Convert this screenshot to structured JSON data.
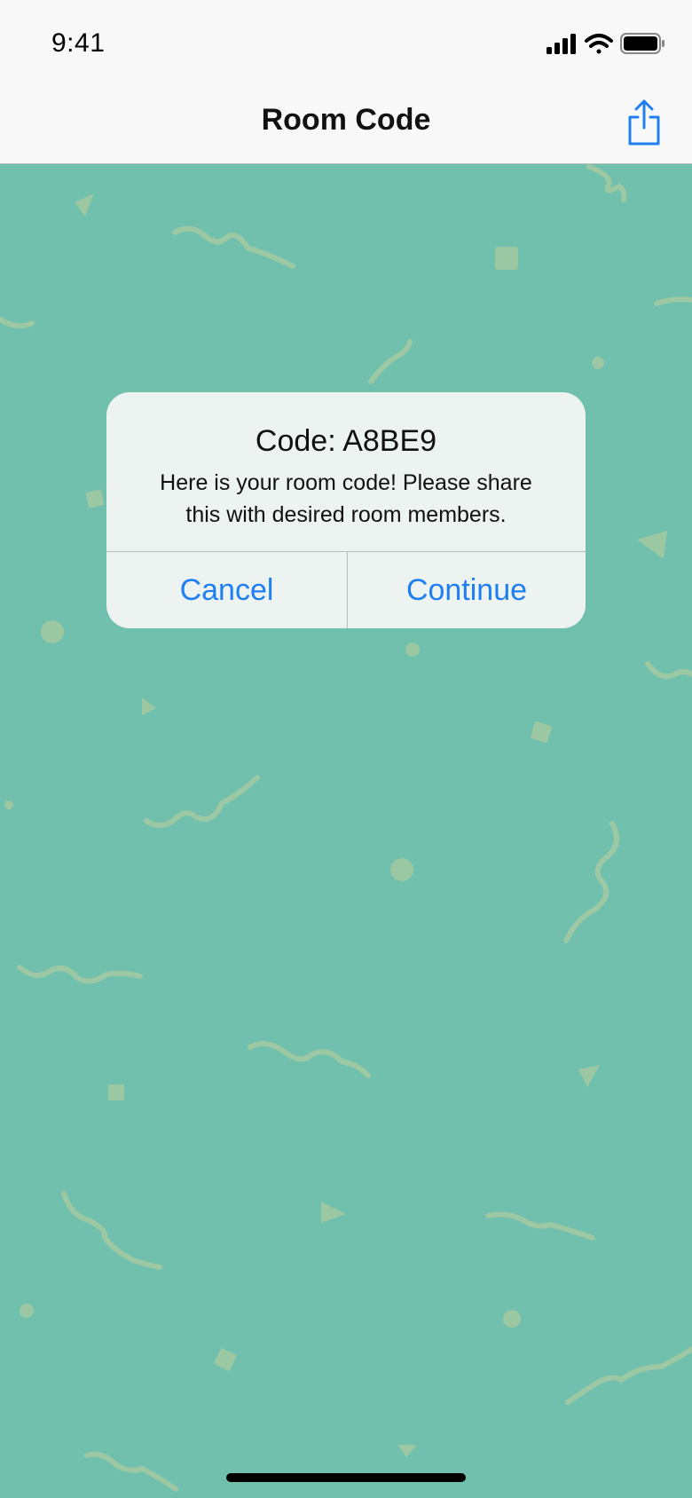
{
  "status_bar": {
    "time": "9:41",
    "icons": [
      "cellular-signal-icon",
      "wifi-icon",
      "battery-icon"
    ]
  },
  "nav": {
    "title": "Room Code",
    "share_icon": "share-icon"
  },
  "alert": {
    "title": "Code: A8BE9",
    "message_line1": "Here is your room code! Please share",
    "message_line2": "this with desired room members.",
    "cancel_label": "Cancel",
    "continue_label": "Continue"
  },
  "colors": {
    "background": "#71bfad",
    "confetti": "#a3c9a1",
    "accent": "#1f7ff0",
    "alert_bg": "#edf3f1"
  }
}
